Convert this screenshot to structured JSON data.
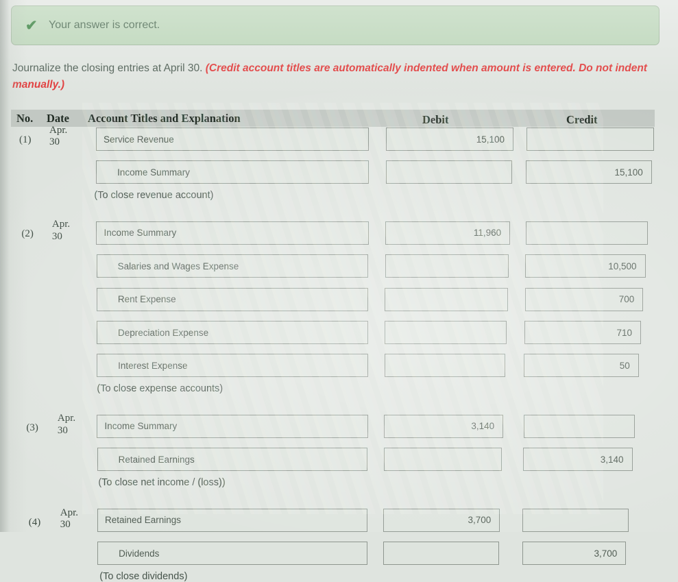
{
  "banner": {
    "icon": "checkmark-icon",
    "glyph": "✔",
    "text": "Your answer is correct.",
    "bg_color": "#b9d4b6",
    "text_color": "#3f5f46",
    "check_color": "#2d7a35"
  },
  "instructions": {
    "lead": "Journalize the closing entries at April 30. ",
    "warning": "(Credit account titles are automatically indented when amount is entered. Do not indent manually.)",
    "warning_color": "#e03a3a"
  },
  "table": {
    "headers": {
      "no": "No.",
      "date": "Date",
      "account": "Account Titles and Explanation",
      "debit": "Debit",
      "credit": "Credit"
    },
    "header_bg": "#c2c8c3",
    "entries": [
      {
        "no": "(1)",
        "date_line1": "Apr.",
        "date_line2": "30",
        "lines": [
          {
            "account": "Service Revenue",
            "indent": false,
            "debit": "15,100",
            "credit": ""
          },
          {
            "account": "Income Summary",
            "indent": true,
            "debit": "",
            "credit": "15,100"
          }
        ],
        "caption": "(To close revenue account)"
      },
      {
        "no": "(2)",
        "date_line1": "Apr.",
        "date_line2": "30",
        "lines": [
          {
            "account": "Income Summary",
            "indent": false,
            "debit": "11,960",
            "credit": ""
          },
          {
            "account": "Salaries and Wages Expense",
            "indent": true,
            "debit": "",
            "credit": "10,500"
          },
          {
            "account": "Rent Expense",
            "indent": true,
            "debit": "",
            "credit": "700"
          },
          {
            "account": "Depreciation Expense",
            "indent": true,
            "debit": "",
            "credit": "710"
          },
          {
            "account": "Interest Expense",
            "indent": true,
            "debit": "",
            "credit": "50"
          }
        ],
        "caption": "(To close expense accounts)"
      },
      {
        "no": "(3)",
        "date_line1": "Apr.",
        "date_line2": "30",
        "lines": [
          {
            "account": "Income Summary",
            "indent": false,
            "debit": "3,140",
            "credit": ""
          },
          {
            "account": "Retained Earnings",
            "indent": true,
            "debit": "",
            "credit": "3,140"
          }
        ],
        "caption": "(To close net income / (loss))"
      },
      {
        "no": "(4)",
        "date_line1": "Apr.",
        "date_line2": "30",
        "lines": [
          {
            "account": "Retained Earnings",
            "indent": false,
            "debit": "3,700",
            "credit": ""
          },
          {
            "account": "Dividends",
            "indent": true,
            "debit": "",
            "credit": "3,700"
          }
        ],
        "caption": "(To close dividends)"
      }
    ]
  }
}
